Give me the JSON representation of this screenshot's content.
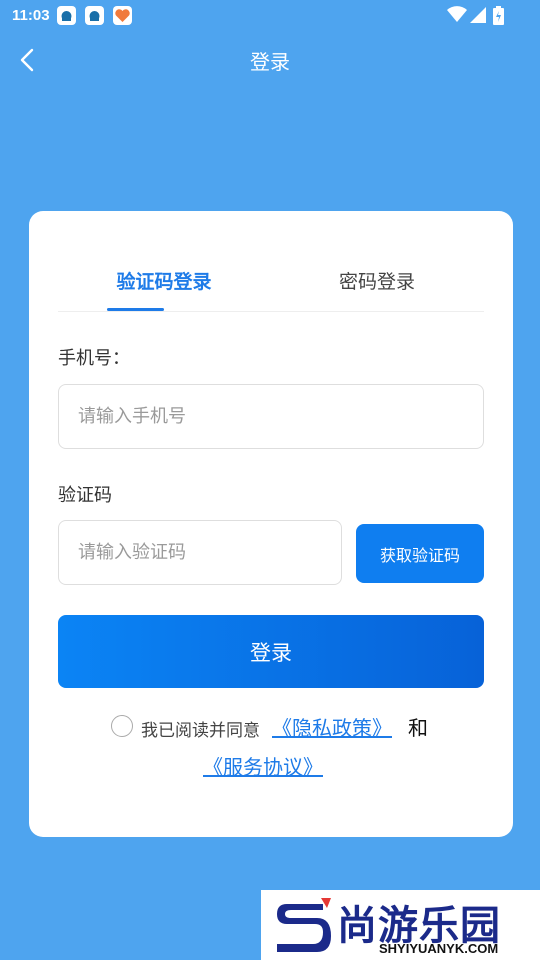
{
  "status_bar": {
    "time": "11:03"
  },
  "header": {
    "title": "登录"
  },
  "tabs": [
    {
      "label": "验证码登录",
      "active": true
    },
    {
      "label": "密码登录",
      "active": false
    }
  ],
  "form": {
    "phone_label": "手机号：",
    "phone_placeholder": "请输入手机号",
    "phone_value": "",
    "code_label": "验证码",
    "code_placeholder": "请输入验证码",
    "code_value": "",
    "get_code_label": "获取验证码",
    "login_label": "登录"
  },
  "agreement": {
    "checked": false,
    "prefix": "我已阅读并同意",
    "privacy_link": "《隐私政策》",
    "conjunction": "和",
    "terms_link": "《服务协议》"
  },
  "watermark": {
    "brand": "尚游乐园",
    "url": "SHYIYUANYK.COM"
  },
  "colors": {
    "background": "#4ea4ef",
    "accent": "#1e7be8",
    "button": "#0f7ef0"
  },
  "icons": [
    "back-arrow-icon",
    "notification-app-icon",
    "wifi-icon",
    "signal-icon",
    "battery-icon",
    "radio-unchecked-icon"
  ]
}
